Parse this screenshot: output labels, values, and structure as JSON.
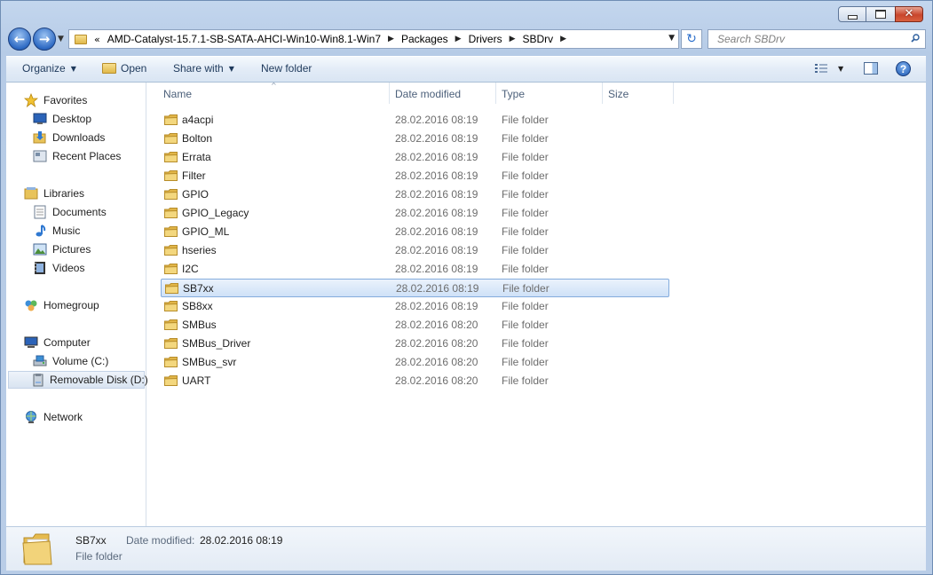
{
  "window": {
    "minimize_glyph": "",
    "maximize_glyph": "",
    "close_glyph": "✕"
  },
  "navigation": {
    "back_glyph": "←",
    "forward_glyph": "→",
    "recent_glyph": "▼",
    "overflow_glyph": "«",
    "crumb_separator": "▶",
    "address_dropdown_glyph": "▼",
    "refresh_glyph": "↻",
    "breadcrumbs": [
      "AMD-Catalyst-15.7.1-SB-SATA-AHCI-Win10-Win8.1-Win7",
      "Packages",
      "Drivers",
      "SBDrv"
    ]
  },
  "search": {
    "placeholder": "Search SBDrv"
  },
  "toolbar": {
    "organize": "Organize",
    "open": "Open",
    "share_with": "Share with",
    "new_folder": "New folder",
    "dropdown_glyph": "▼",
    "help_glyph": "?"
  },
  "sidebar": {
    "favorites": "Favorites",
    "desktop": "Desktop",
    "downloads": "Downloads",
    "recent_places": "Recent Places",
    "libraries": "Libraries",
    "documents": "Documents",
    "music": "Music",
    "pictures": "Pictures",
    "videos": "Videos",
    "homegroup": "Homegroup",
    "computer": "Computer",
    "volume_c": "Volume (C:)",
    "removable_disk": "Removable Disk (D:)",
    "network": "Network"
  },
  "columns": {
    "name": "Name",
    "date_modified": "Date modified",
    "type": "Type",
    "size": "Size",
    "sort_glyph": "^"
  },
  "files": [
    {
      "name": "a4acpi",
      "date": "28.02.2016 08:19",
      "type": "File folder"
    },
    {
      "name": "Bolton",
      "date": "28.02.2016 08:19",
      "type": "File folder"
    },
    {
      "name": "Errata",
      "date": "28.02.2016 08:19",
      "type": "File folder"
    },
    {
      "name": "Filter",
      "date": "28.02.2016 08:19",
      "type": "File folder"
    },
    {
      "name": "GPIO",
      "date": "28.02.2016 08:19",
      "type": "File folder"
    },
    {
      "name": "GPIO_Legacy",
      "date": "28.02.2016 08:19",
      "type": "File folder"
    },
    {
      "name": "GPIO_ML",
      "date": "28.02.2016 08:19",
      "type": "File folder"
    },
    {
      "name": "hseries",
      "date": "28.02.2016 08:19",
      "type": "File folder"
    },
    {
      "name": "I2C",
      "date": "28.02.2016 08:19",
      "type": "File folder"
    },
    {
      "name": "SB7xx",
      "date": "28.02.2016 08:19",
      "type": "File folder"
    },
    {
      "name": "SB8xx",
      "date": "28.02.2016 08:19",
      "type": "File folder"
    },
    {
      "name": "SMBus",
      "date": "28.02.2016 08:20",
      "type": "File folder"
    },
    {
      "name": "SMBus_Driver",
      "date": "28.02.2016 08:20",
      "type": "File folder"
    },
    {
      "name": "SMBus_svr",
      "date": "28.02.2016 08:20",
      "type": "File folder"
    },
    {
      "name": "UART",
      "date": "28.02.2016 08:20",
      "type": "File folder"
    }
  ],
  "details": {
    "name": "SB7xx",
    "date_label": "Date modified:",
    "date_value": "28.02.2016 08:19",
    "type": "File folder"
  },
  "colors": {
    "selection_border": "#84acdd",
    "folder_yellow": "#e8c35a"
  }
}
